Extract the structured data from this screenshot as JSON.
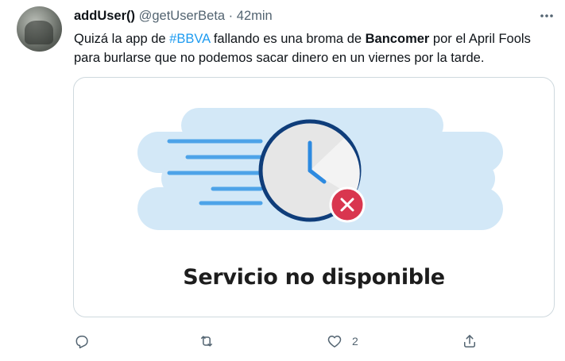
{
  "tweet": {
    "display_name": "addUser()",
    "handle": "@getUserBeta",
    "separator": "·",
    "time": "42min",
    "text_part1": "Quizá la app de ",
    "hashtag": "#BBVA",
    "text_part2": " fallando es una broma de ",
    "bold_word": "Bancomer",
    "text_part3": " por el April Fools para burlarse que no podemos sacar dinero en un viernes por la tarde.",
    "media_caption": "Servicio no disponible",
    "like_count": "2"
  },
  "colors": {
    "accent": "#1d9bf0",
    "secondary_text": "#536471",
    "clock_ring": "#0f3d7a",
    "error_red": "#d9364f",
    "cloud_blue": "#d3e8f7"
  },
  "icons": {
    "more": "more-horizontal-icon",
    "reply": "reply-icon",
    "retweet": "retweet-icon",
    "like": "heart-icon",
    "share": "share-icon"
  }
}
